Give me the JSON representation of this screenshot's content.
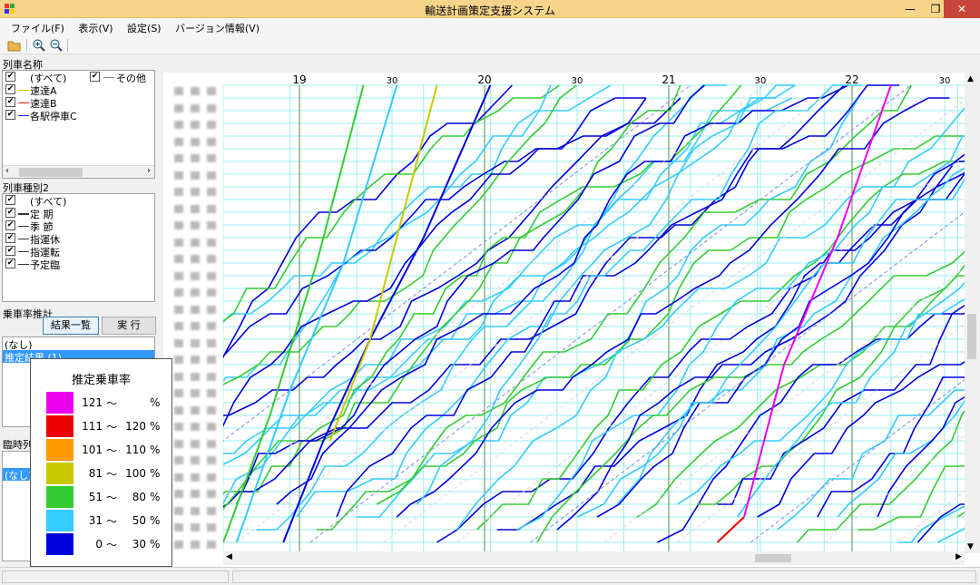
{
  "window": {
    "title": "輸送計画策定支援システム"
  },
  "menu": [
    "ファイル(F)",
    "表示(V)",
    "設定(S)",
    "バージョン情報(V)"
  ],
  "left": {
    "train_name_label": "列車名称",
    "train_names": [
      {
        "label": "(すべて)",
        "checked": true,
        "color": ""
      },
      {
        "label": "速達A",
        "checked": true,
        "color": "#d4c200"
      },
      {
        "label": "速達B",
        "checked": true,
        "color": "#e02020"
      },
      {
        "label": "各駅停車C",
        "checked": true,
        "color": "#2020e0"
      }
    ],
    "other_label": "その他",
    "train_type_label": "列車種別2",
    "train_types": [
      {
        "label": "(すべて)",
        "checked": true
      },
      {
        "label": "定 期",
        "checked": true
      },
      {
        "label": "季 節",
        "checked": true
      },
      {
        "label": "指運休",
        "checked": true
      },
      {
        "label": "指運転",
        "checked": true
      },
      {
        "label": "予定臨",
        "checked": true
      }
    ],
    "ridership_label": "乗車率推計",
    "results_button": "結果一覧",
    "run_button": "実 行",
    "results": [
      "(なし)",
      "推定結果 (1)"
    ],
    "extra_label": "臨時列",
    "extra_list": [
      "(なし)"
    ]
  },
  "legend": {
    "title": "推定乗車率",
    "tilde": "〜",
    "rows": [
      {
        "color": "#ee00ee",
        "from": "121",
        "to": "",
        "unit": "%"
      },
      {
        "color": "#ee0000",
        "from": "111",
        "to": "120",
        "unit": "%"
      },
      {
        "color": "#ff9900",
        "from": "101",
        "to": "110",
        "unit": "%"
      },
      {
        "color": "#c8c800",
        "from": "81",
        "to": "100",
        "unit": "%"
      },
      {
        "color": "#33cc33",
        "from": "51",
        "to": "80",
        "unit": "%"
      },
      {
        "color": "#33ccff",
        "from": "31",
        "to": "50",
        "unit": "%"
      },
      {
        "color": "#0000dd",
        "from": "0",
        "to": "30",
        "unit": "%"
      }
    ]
  },
  "chart_data": {
    "type": "line",
    "title": "",
    "x_ticks": [
      "19",
      "30",
      "20",
      "30",
      "21",
      "30",
      "22",
      "30"
    ],
    "xlabel": "",
    "ylabel": "",
    "grid": true,
    "colors": {
      "0-30": "#0000dd",
      "31-50": "#33ccff",
      "51-80": "#33cc33",
      "81-100": "#c8c800",
      "101-110": "#ff9900",
      "111-120": "#ee0000",
      "121+": "#ee00ee",
      "other": "#9999dd"
    },
    "series": [
      {
        "color": "#0000dd",
        "values": [
          [
            9,
            0
          ],
          [
            15,
            8
          ],
          [
            22,
            16
          ],
          [
            30,
            24
          ],
          [
            40,
            36
          ]
        ]
      },
      {
        "color": "#33ccff",
        "values": [
          [
            2,
            0
          ],
          [
            10,
            12
          ],
          [
            18,
            22
          ],
          [
            26,
            36
          ]
        ]
      },
      {
        "color": "#33cc33",
        "values": [
          [
            0,
            0
          ],
          [
            7,
            10
          ],
          [
            14,
            22
          ],
          [
            21,
            36
          ]
        ]
      },
      {
        "color": "#c8c800",
        "values": [
          [
            16,
            8
          ],
          [
            22,
            16
          ],
          [
            28,
            28
          ],
          [
            32,
            36
          ]
        ]
      },
      {
        "color": "#ee0000",
        "values": [
          [
            74,
            0
          ],
          [
            78,
            2
          ]
        ]
      },
      {
        "color": "#ee00ee",
        "values": [
          [
            78,
            2
          ],
          [
            84,
            14
          ],
          [
            92,
            24
          ],
          [
            100,
            36
          ]
        ]
      }
    ]
  }
}
